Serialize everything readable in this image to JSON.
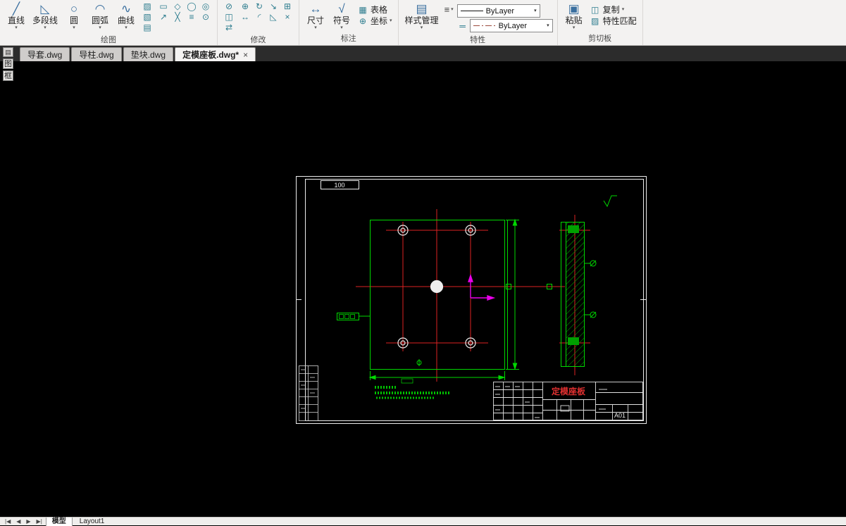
{
  "ui": {
    "caret": "▾"
  },
  "colors": {
    "entity_green": "#00d800",
    "centerline_red": "#dd2222",
    "ucs_magenta": "#ea00ea",
    "title_red": "#e03030",
    "frame_white": "#ededed"
  },
  "ribbon": {
    "draw": {
      "label": "绘图",
      "buttons": [
        {
          "name": "line-button",
          "label": "直线",
          "glyph": "╱"
        },
        {
          "name": "polyline-button",
          "label": "多段线",
          "glyph": "◺"
        },
        {
          "name": "circle-button",
          "label": "圆",
          "glyph": "○"
        },
        {
          "name": "arc-button",
          "label": "圆弧",
          "glyph": "◠"
        },
        {
          "name": "spline-button",
          "label": "曲线",
          "glyph": "∿"
        }
      ],
      "column_icons": [
        {
          "name": "hatch-icon",
          "glyph": "▨"
        },
        {
          "name": "gradient-icon",
          "glyph": "▧"
        },
        {
          "name": "text-icon",
          "glyph": "▤"
        }
      ],
      "grid_icons": [
        {
          "name": "rectangle-icon",
          "glyph": "▭"
        },
        {
          "name": "polygon-icon",
          "glyph": "◇"
        },
        {
          "name": "ellipse-icon",
          "glyph": "◯"
        },
        {
          "name": "donut-icon",
          "glyph": "◎"
        },
        {
          "name": "ray-icon",
          "glyph": "↗"
        },
        {
          "name": "construction-line-icon",
          "glyph": "╳"
        },
        {
          "name": "multiline-icon",
          "glyph": "≡"
        },
        {
          "name": "point-icon",
          "glyph": "⊙"
        }
      ]
    },
    "modify": {
      "label": "修改",
      "column_icons": [
        {
          "name": "erase-icon",
          "glyph": "⊘"
        },
        {
          "name": "copy-object-icon",
          "glyph": "◫"
        },
        {
          "name": "mirror-icon",
          "glyph": "⇄"
        }
      ],
      "grid_icons": [
        {
          "name": "move-icon",
          "glyph": "⊕"
        },
        {
          "name": "rotate-icon",
          "glyph": "↻"
        },
        {
          "name": "scale-icon",
          "glyph": "↘"
        },
        {
          "name": "array-icon",
          "glyph": "⊞"
        },
        {
          "name": "stretch-icon",
          "glyph": "↔"
        },
        {
          "name": "fillet-icon",
          "glyph": "◜"
        },
        {
          "name": "chamfer-icon",
          "glyph": "◺"
        },
        {
          "name": "trim-icon",
          "glyph": "×"
        }
      ]
    },
    "annotate": {
      "label": "标注",
      "dimension": {
        "label": "尺寸",
        "glyph": "↔"
      },
      "symbol": {
        "label": "符号",
        "glyph": "√"
      },
      "table": {
        "label": "表格",
        "glyph": "▦"
      },
      "coordinate": {
        "label": "坐标",
        "glyph": "⊕"
      }
    },
    "properties": {
      "label": "特性",
      "style_manager": {
        "label": "样式管理",
        "glyph": "▤"
      },
      "menu_glyph": "≡",
      "lineweight_glyph": "═",
      "linetype_value": "ByLayer",
      "linetype2_value": "ByLayer"
    },
    "clipboard": {
      "label": "剪切板",
      "paste": {
        "label": "粘贴",
        "glyph": "▣"
      },
      "copy": {
        "label": "复制",
        "glyph": "◫"
      },
      "match": {
        "label": "特性匹配",
        "glyph": "▨"
      }
    }
  },
  "doc_tabs": {
    "close_glyph": "×",
    "tabs": [
      {
        "label": "导套.dwg",
        "active": false
      },
      {
        "label": "导柱.dwg",
        "active": false
      },
      {
        "label": "垫块.dwg",
        "active": false
      },
      {
        "label": "定模座板.dwg*",
        "active": true
      }
    ]
  },
  "side_palette": {
    "icon_glyph": "▤",
    "chars": [
      "图",
      "框"
    ]
  },
  "drawing": {
    "frame_label": "100",
    "title_block": {
      "title": "定模座板",
      "code": "A01"
    }
  },
  "statusbar": {
    "nav": [
      "|◀",
      "◀",
      "▶",
      "▶|"
    ],
    "model_tab": "模型",
    "layout_tab": "Layout1"
  }
}
